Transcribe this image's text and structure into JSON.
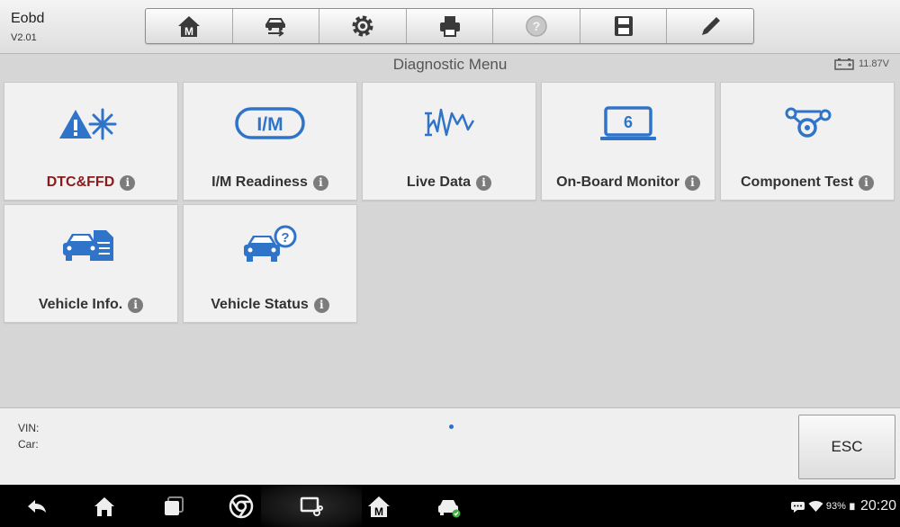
{
  "app": {
    "name": "Eobd",
    "version": "V2.01"
  },
  "toolbar": [
    {
      "id": "home",
      "icon": "home-m-icon"
    },
    {
      "id": "vehicle-swap",
      "icon": "vehicle-swap-icon"
    },
    {
      "id": "settings",
      "icon": "gear-icon"
    },
    {
      "id": "print",
      "icon": "printer-icon"
    },
    {
      "id": "help",
      "icon": "help-icon"
    },
    {
      "id": "save",
      "icon": "save-icon"
    },
    {
      "id": "edit",
      "icon": "pencil-icon"
    }
  ],
  "header": {
    "title": "Diagnostic Menu",
    "battery_voltage": "11.87V"
  },
  "tiles": [
    {
      "label": "DTC&FFD",
      "icon": "warning-snowflake-icon",
      "label_color": "#8b1a1a"
    },
    {
      "label": "I/M Readiness",
      "icon": "im-readiness-icon",
      "label_color": "#333333"
    },
    {
      "label": "Live Data",
      "icon": "live-data-icon",
      "label_color": "#333333"
    },
    {
      "label": "On-Board Monitor",
      "icon": "onboard-monitor-icon",
      "label_color": "#333333"
    },
    {
      "label": "Component Test",
      "icon": "component-test-icon",
      "label_color": "#333333"
    },
    {
      "label": "Vehicle Info.",
      "icon": "vehicle-info-icon",
      "label_color": "#333333"
    },
    {
      "label": "Vehicle Status",
      "icon": "vehicle-status-icon",
      "label_color": "#333333"
    }
  ],
  "info": {
    "vin_label": "VIN:",
    "car_label": "Car:"
  },
  "esc_label": "ESC",
  "navbar": {
    "items": [
      "back-icon",
      "home-icon",
      "recent-apps-icon",
      "chrome-icon",
      "screen-capture-icon",
      "home-m-icon",
      "car-diagnostic-icon"
    ],
    "battery_percent": "93%",
    "time": "20:20"
  },
  "colors": {
    "icon_blue": "#2f74c9",
    "accent_dark_red": "#8b1a1a",
    "page_dot": "#2a72c8"
  }
}
